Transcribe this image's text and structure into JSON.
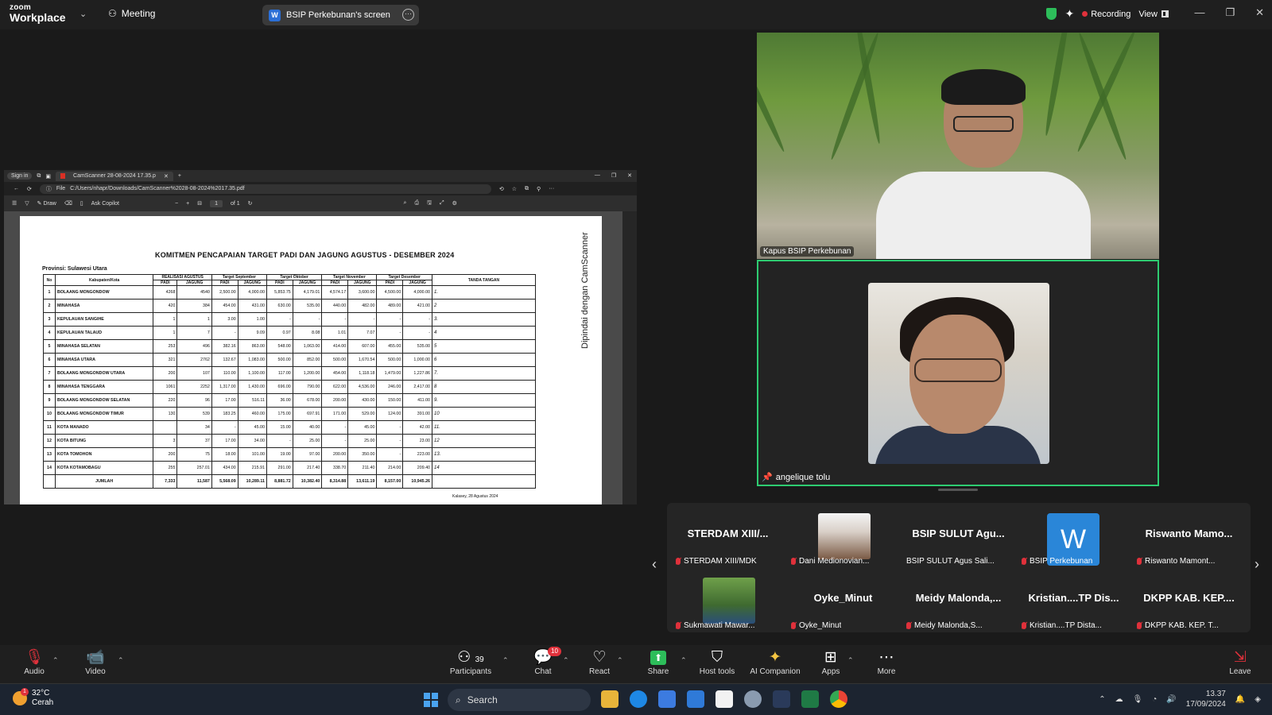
{
  "topbar": {
    "logo_line1": "zoom",
    "logo_line2": "Workplace",
    "meeting_label": "Meeting",
    "screen_pill_label": "BSIP Perkebunan's screen",
    "screen_pill_initial": "W",
    "recording_label": "Recording",
    "view_label": "View",
    "colors": {
      "recording": "#e0313b",
      "shield": "#2dbd5a"
    }
  },
  "edge": {
    "signin": "Sign in",
    "tab_title": "CamScanner 28-08-2024 17.35.p",
    "address_prefix": "File",
    "address": "C:/Users/nhapr/Downloads/CamScanner%2028-08-2024%2017.35.pdf",
    "draw_label": "Draw",
    "copilot_label": "Ask Copilot",
    "page_number": "1",
    "page_of": "of 1"
  },
  "document": {
    "title": "KOMITMEN PENCAPAIAN TARGET PADI DAN JAGUNG AGUSTUS - DESEMBER 2024",
    "province": "Provinsi: Sulawesi Utara",
    "side_watermark": "Dipindai dengan CamScanner",
    "headers": {
      "no": "No",
      "kab": "Kabupaten/Kota",
      "realisasi": "REALISASI AGUSTUS",
      "sep": "Target September",
      "okt": "Target Oktober",
      "nov": "Target November",
      "des": "Target Desember",
      "ttd": "TANDA TANGAN",
      "padi": "PADI",
      "jagung": "JAGUNG"
    },
    "rows": [
      {
        "no": "1",
        "name": "BOLAANG MONGONDOW",
        "v": [
          "4268",
          "4540",
          "2,500.00",
          "4,000.00",
          "5,853.75",
          "4,179.01",
          "4,574.17",
          "3,600.00",
          "4,500.00",
          "4,000.00"
        ],
        "sig": "1."
      },
      {
        "no": "2",
        "name": "MINAHASA",
        "v": [
          "420",
          "384",
          "454.00",
          "431.00",
          "630.00",
          "535.00",
          "440.00",
          "482.00",
          "489.00",
          "421.00"
        ],
        "sig": "2"
      },
      {
        "no": "3",
        "name": "KEPULAUAN SANGIHE",
        "v": [
          "1",
          "1",
          "3.00",
          "1.00",
          "-",
          "-",
          "-",
          "-",
          "-",
          "-"
        ],
        "sig": "3."
      },
      {
        "no": "4",
        "name": "KEPULAUAN TALAUD",
        "v": [
          "1",
          "7",
          "-",
          "9.09",
          "0.97",
          "8.08",
          "1.01",
          "7.07",
          "-",
          "-"
        ],
        "sig": "4"
      },
      {
        "no": "5",
        "name": "MINAHASA SELATAN",
        "v": [
          "253",
          "496",
          "382.16",
          "863.00",
          "548.00",
          "1,063.00",
          "414.00",
          "607.00",
          "455.00",
          "535.00"
        ],
        "sig": "5"
      },
      {
        "no": "6",
        "name": "MINAHASA UTARA",
        "v": [
          "321",
          "2762",
          "132.67",
          "1,083.00",
          "500.00",
          "852.00",
          "500.00",
          "1,670.54",
          "500.00",
          "1,000.00"
        ],
        "sig": "6"
      },
      {
        "no": "7",
        "name": "BOLAANG MONGONDOW UTARA",
        "v": [
          "200",
          "107",
          "110.00",
          "1,100.00",
          "117.00",
          "1,200.00",
          "454.00",
          "1,118.18",
          "1,479.00",
          "1,227.86"
        ],
        "sig": "7."
      },
      {
        "no": "8",
        "name": "MINAHASA TENGGARA",
        "v": [
          "1061",
          "2252",
          "1,317.00",
          "1,430.00",
          "696.00",
          "790.00",
          "622.00",
          "4,536.00",
          "246.00",
          "2,417.00"
        ],
        "sig": "8"
      },
      {
        "no": "9",
        "name": "BOLAANG MONGONDOW SELATAN",
        "v": [
          "220",
          "96",
          "17.00",
          "516.11",
          "36.00",
          "678.00",
          "200.00",
          "430.00",
          "150.00",
          "411.00"
        ],
        "sig": "9."
      },
      {
        "no": "10",
        "name": "BOLAANG MONGONDOW TIMUR",
        "v": [
          "130",
          "539",
          "183.25",
          "460.00",
          "175.00",
          "697.91",
          "171.00",
          "529.00",
          "124.00",
          "391.00"
        ],
        "sig": "10"
      },
      {
        "no": "11",
        "name": "KOTA MANADO",
        "v": [
          "",
          "34",
          "-",
          "45.00",
          "15.00",
          "40.00",
          "-",
          "45.00",
          "-",
          "42.00"
        ],
        "sig": "11."
      },
      {
        "no": "12",
        "name": "KOTA BITUNG",
        "v": [
          "3",
          "37",
          "17.00",
          "34.00",
          "-",
          "25.00",
          "-",
          "25.00",
          "-",
          "23.00"
        ],
        "sig": "12"
      },
      {
        "no": "13",
        "name": "KOTA TOMOHON",
        "v": [
          "200",
          "75",
          "18.00",
          "101.00",
          "19.00",
          "97.00",
          "200.00",
          "350.00",
          "-",
          "223.00"
        ],
        "sig": "13."
      },
      {
        "no": "14",
        "name": "KOTA KOTAMOBAGU",
        "v": [
          "255",
          "257.01",
          "434.00",
          "215.91",
          "291.00",
          "217.40",
          "338.70",
          "211.40",
          "214.00",
          "209.40"
        ],
        "sig": "14"
      }
    ],
    "total": {
      "label": "JUMLAH",
      "v": [
        "7,333",
        "11,587",
        "5,568.09",
        "10,289.11",
        "8,881.72",
        "10,382.40",
        "8,314.88",
        "13,611.19",
        "8,157.00",
        "10,945.26"
      ]
    },
    "footer": "Kalasey, 28 Agustus 2024"
  },
  "videos": {
    "main1_name": "Kapus BSIP Perkebunan",
    "main2_name": "angelique tolu"
  },
  "gallery": [
    {
      "big": "STERDAM XIII/...",
      "small": "STERDAM XIII/MDK",
      "type": "text"
    },
    {
      "big": "",
      "small": "Dani Medionovian...",
      "type": "photo"
    },
    {
      "big": "BSIP SULUT Agu...",
      "small": "BSIP SULUT Agus Sali...",
      "type": "text"
    },
    {
      "big": "W",
      "small": "BSIP Perkebunan",
      "type": "avatar"
    },
    {
      "big": "Riswanto  Mamo...",
      "small": "Riswanto Mamont...",
      "type": "text"
    },
    {
      "big": "",
      "small": "Sukmawati Mawar...",
      "type": "photo"
    },
    {
      "big": "Oyke_Minut",
      "small": "Oyke_Minut",
      "type": "text"
    },
    {
      "big": "Meidy  Malonda,...",
      "small": "Meidy Malonda,S...",
      "type": "text"
    },
    {
      "big": "Kristian....TP  Dis...",
      "small": "Kristian....TP Dista...",
      "type": "text"
    },
    {
      "big": "DKPP KAB. KEP....",
      "small": "DKPP KAB. KEP. T...",
      "type": "text"
    }
  ],
  "controls": {
    "audio": "Audio",
    "video": "Video",
    "participants": "Participants",
    "participants_count": "39",
    "chat": "Chat",
    "chat_badge": "10",
    "react": "React",
    "share": "Share",
    "host_tools": "Host tools",
    "ai": "AI Companion",
    "apps": "Apps",
    "more": "More",
    "leave": "Leave"
  },
  "taskbar": {
    "temp": "32°C",
    "weather": "Cerah",
    "weather_badge": "1",
    "search": "Search",
    "time": "13.37",
    "date": "17/09/2024"
  }
}
